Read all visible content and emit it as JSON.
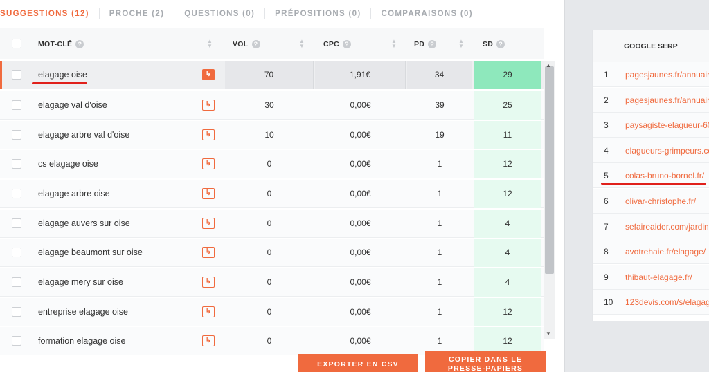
{
  "tabs": [
    {
      "label": "SUGGESTIONS (12)",
      "active": true
    },
    {
      "label": "PROCHE (2)",
      "active": false
    },
    {
      "label": "QUESTIONS (0)",
      "active": false
    },
    {
      "label": "PRÉPOSITIONS (0)",
      "active": false
    },
    {
      "label": "COMPARAISONS (0)",
      "active": false
    }
  ],
  "table": {
    "headers": {
      "keyword": "MOT-CLÉ",
      "vol": "VOL",
      "cpc": "CPC",
      "pd": "PD",
      "sd": "SD"
    },
    "info_glyph": "?",
    "rows": [
      {
        "keyword": "elagage oise",
        "vol": "70",
        "cpc": "1,91€",
        "pd": "34",
        "sd": "29"
      },
      {
        "keyword": "elagage val d'oise",
        "vol": "30",
        "cpc": "0,00€",
        "pd": "39",
        "sd": "25"
      },
      {
        "keyword": "elagage arbre val d'oise",
        "vol": "10",
        "cpc": "0,00€",
        "pd": "19",
        "sd": "11"
      },
      {
        "keyword": "cs elagage oise",
        "vol": "0",
        "cpc": "0,00€",
        "pd": "1",
        "sd": "12"
      },
      {
        "keyword": "elagage arbre oise",
        "vol": "0",
        "cpc": "0,00€",
        "pd": "1",
        "sd": "12"
      },
      {
        "keyword": "elagage auvers sur oise",
        "vol": "0",
        "cpc": "0,00€",
        "pd": "1",
        "sd": "4"
      },
      {
        "keyword": "elagage beaumont sur oise",
        "vol": "0",
        "cpc": "0,00€",
        "pd": "1",
        "sd": "4"
      },
      {
        "keyword": "elagage mery sur oise",
        "vol": "0",
        "cpc": "0,00€",
        "pd": "1",
        "sd": "4"
      },
      {
        "keyword": "entreprise elagage oise",
        "vol": "0",
        "cpc": "0,00€",
        "pd": "1",
        "sd": "12"
      },
      {
        "keyword": "formation elagage oise",
        "vol": "0",
        "cpc": "0,00€",
        "pd": "1",
        "sd": "12"
      }
    ],
    "selected_row": 0,
    "go_icon": "↳"
  },
  "buttons": {
    "export_csv": "EXPORTER EN CSV",
    "copy_line1": "COPIER DANS LE",
    "copy_line2": "PRESSE-PAPIERS"
  },
  "serp": {
    "title": "GOOGLE SERP",
    "results": [
      {
        "rank": "1",
        "url": "pagesjaunes.fr/annuaire"
      },
      {
        "rank": "2",
        "url": "pagesjaunes.fr/annuaire"
      },
      {
        "rank": "3",
        "url": "paysagiste-elagueur-60"
      },
      {
        "rank": "4",
        "url": "elagueurs-grimpeurs.co"
      },
      {
        "rank": "5",
        "url": "colas-bruno-bornel.fr/"
      },
      {
        "rank": "6",
        "url": "olivar-christophe.fr/"
      },
      {
        "rank": "7",
        "url": "sefaireaider.com/jardin"
      },
      {
        "rank": "8",
        "url": "avotrehaie.fr/elagage/"
      },
      {
        "rank": "9",
        "url": "thibaut-elagage.fr/"
      },
      {
        "rank": "10",
        "url": "123devis.com/s/elagag"
      }
    ]
  },
  "colors": {
    "accent": "#f06a3e",
    "sd_highlight": "#8ee8bc",
    "sd_column": "#e6faf0",
    "annotation": "#e0201b"
  }
}
